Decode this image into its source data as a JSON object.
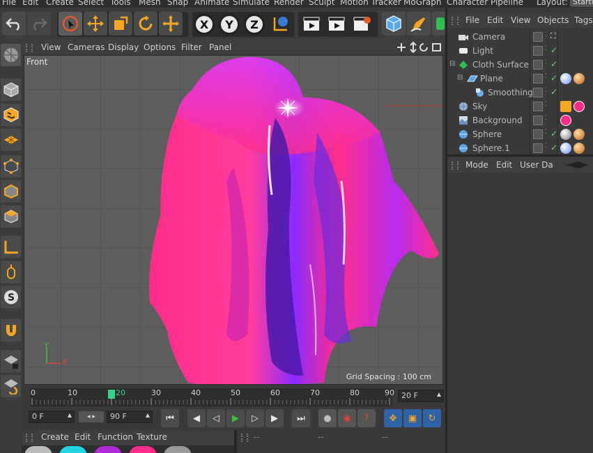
{
  "menubar": {
    "items": [
      "File",
      "Edit",
      "Create",
      "Select",
      "Tools",
      "Mesh",
      "Snap",
      "Animate",
      "Simulate",
      "Render",
      "Sculpt",
      "Motion Tracker",
      "MoGraph",
      "Character",
      "Pipeline"
    ],
    "layout_label": "Layout:",
    "layout_value": "Startu"
  },
  "viewport": {
    "menu": [
      "View",
      "Cameras",
      "Display",
      "Options",
      "Filter",
      "Panel"
    ],
    "view_name": "Front",
    "grid_spacing": "Grid Spacing : 100 cm",
    "axis_y": "Y",
    "axis_x": "X"
  },
  "timeline": {
    "ticks": [
      "0",
      "10",
      "20",
      "30",
      "40",
      "50",
      "60",
      "70",
      "80",
      "90"
    ],
    "current_frame_marker": "20",
    "end_field": "20 F",
    "start_field": "0 F",
    "max_field": "90 F"
  },
  "bottom": {
    "menu": [
      "Create",
      "Edit",
      "Function",
      "Texture"
    ],
    "dashes": [
      "--",
      "--",
      "--"
    ]
  },
  "object_manager": {
    "menu": [
      "File",
      "Edit",
      "View",
      "Objects",
      "Tags"
    ],
    "objects": [
      {
        "name": "Camera",
        "indent": 0
      },
      {
        "name": "Light",
        "indent": 0
      },
      {
        "name": "Cloth Surface",
        "indent": 0
      },
      {
        "name": "Plane",
        "indent": 1
      },
      {
        "name": "Smoothing",
        "indent": 2
      },
      {
        "name": "Sky",
        "indent": 0
      },
      {
        "name": "Background",
        "indent": 0
      },
      {
        "name": "Sphere",
        "indent": 0
      },
      {
        "name": "Sphere.1",
        "indent": 0
      }
    ]
  },
  "attributes": {
    "menu": [
      "Mode",
      "Edit",
      "User Da"
    ]
  },
  "colors": {
    "cloth_pink": "#ff2d8a",
    "cloth_violet": "#7a2bff",
    "accent_orange": "#f5a623",
    "check_green": "#6cd36c"
  }
}
